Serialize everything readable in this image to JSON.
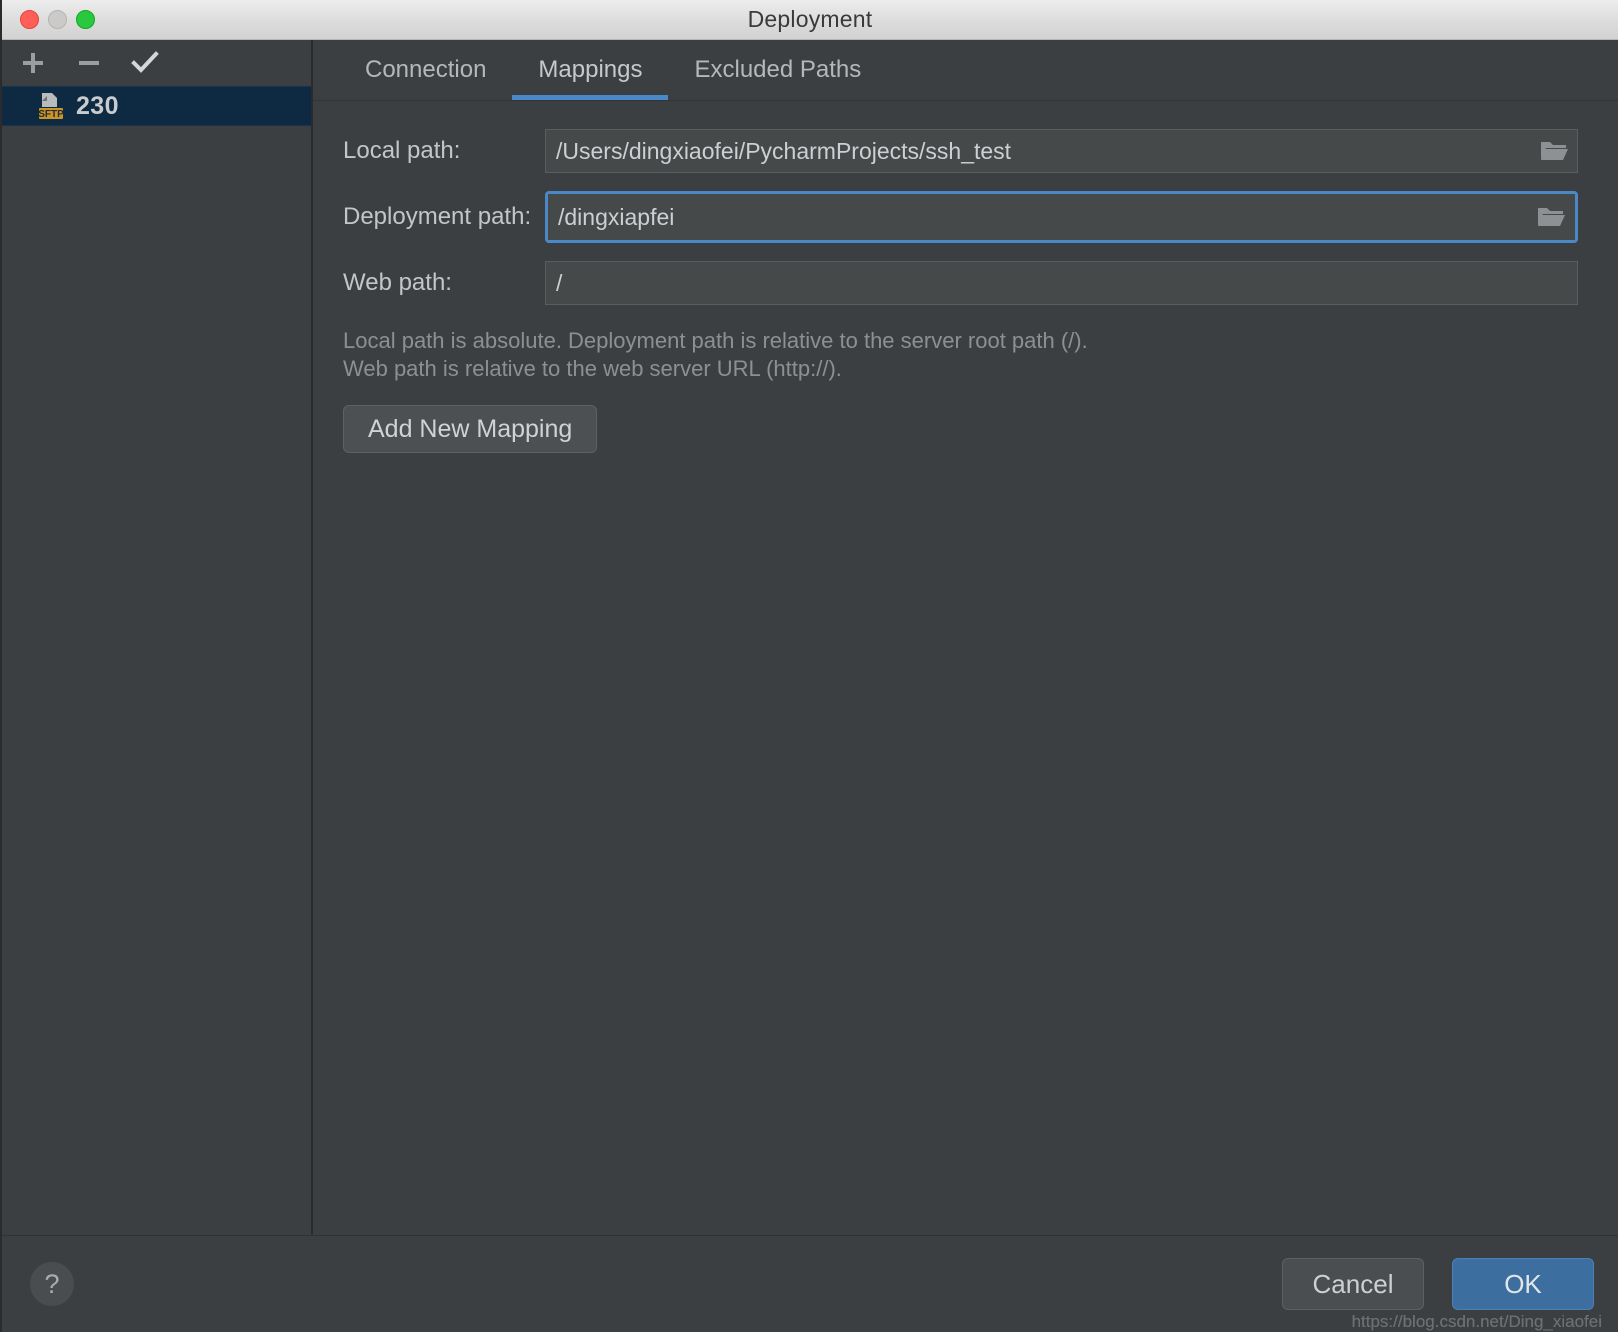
{
  "window": {
    "title": "Deployment",
    "traffic_lights": [
      "close",
      "minimize",
      "maximize"
    ]
  },
  "sidebar": {
    "toolbar": [
      {
        "name": "add",
        "icon": "plus-icon",
        "label": "+"
      },
      {
        "name": "remove",
        "icon": "minus-icon",
        "label": "−"
      },
      {
        "name": "set-default",
        "icon": "check-icon",
        "label": "✓"
      }
    ],
    "servers": [
      {
        "name": "230",
        "protocol_badge": "SFTP",
        "selected": true
      }
    ]
  },
  "tabs": [
    {
      "label": "Connection",
      "active": false
    },
    {
      "label": "Mappings",
      "active": true
    },
    {
      "label": "Excluded Paths",
      "active": false
    }
  ],
  "form": {
    "local_path": {
      "label": "Local path:",
      "value": "/Users/dingxiaofei/PycharmProjects/ssh_test",
      "placeholder": "",
      "browse_icon": "folder-icon"
    },
    "deployment_path": {
      "label": "Deployment path:",
      "value": "/dingxiapfei",
      "placeholder": "",
      "browse_icon": "folder-icon",
      "focused": true
    },
    "web_path": {
      "label": "Web path:",
      "value": "/",
      "placeholder": ""
    },
    "hint_line_1": "Local path is absolute. Deployment path is relative to the server root path (/).",
    "hint_line_2": "Web path is relative to the web server URL (http://).",
    "add_mapping_label": "Add New Mapping"
  },
  "footer": {
    "help_label": "?",
    "cancel_label": "Cancel",
    "ok_label": "OK",
    "watermark_front": "https://blog.csdn.net/Ding_xiaofei",
    "watermark_back": "https://blog.csdn.net/Ding_xiaofei"
  },
  "colors": {
    "background": "#3c3f41",
    "field_background": "#45494a",
    "accent_blue": "#4a88c7",
    "ok_button": "#3c6e9f",
    "selection_blue": "#0d2a42",
    "sftp_badge": "#c9952b"
  }
}
